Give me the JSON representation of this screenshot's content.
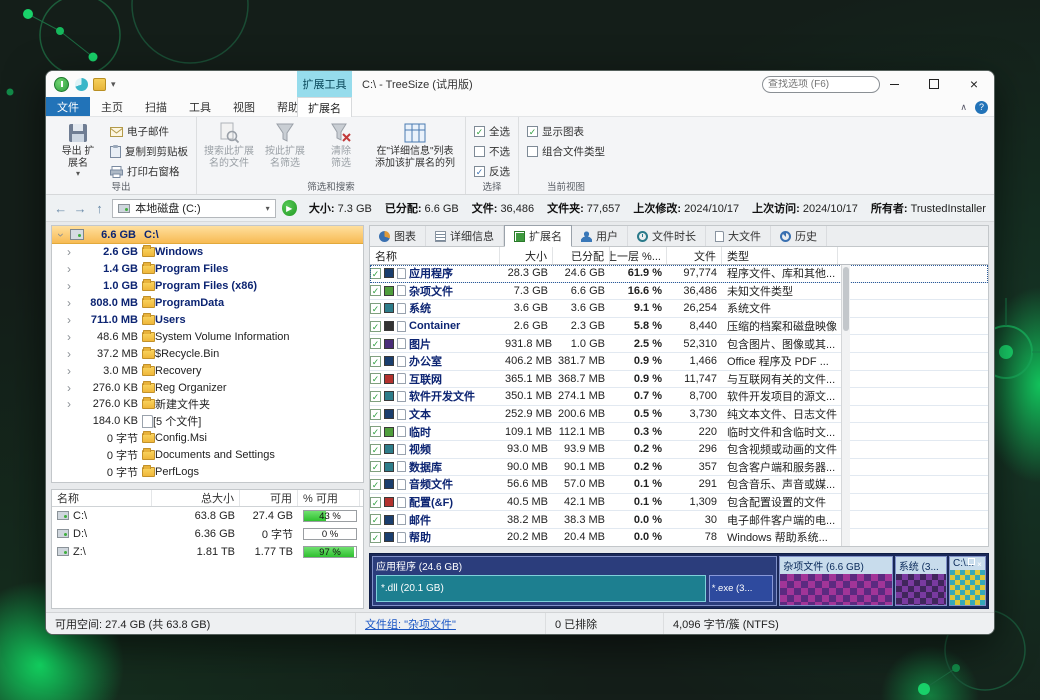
{
  "window": {
    "title": "C:\\ - TreeSize (试用版)",
    "search_placeholder": "查找选项 (F6)",
    "context_group": "扩展工具"
  },
  "ribbon": {
    "tabs": [
      "文件",
      "主页",
      "扫描",
      "工具",
      "视图",
      "帮助"
    ],
    "context_tab": "扩展名",
    "export": {
      "label": "导出",
      "main": "导出 扩\n展名",
      "email": "电子邮件",
      "clipboard": "复制到剪贴板",
      "print": "打印右窗格"
    },
    "filter": {
      "label": "筛选和搜索",
      "search": "搜索此扩展\n名的文件",
      "filter_btn": "按此扩展\n名筛选",
      "clear": "清除\n筛选",
      "addcol": "在\"详细信息\"列表\n添加该扩展名的列"
    },
    "select": {
      "label": "选择",
      "all": "全选",
      "none": "不选",
      "invert": "反选"
    },
    "view": {
      "label": "当前视图",
      "chart": "显示图表",
      "combine": "组合文件类型"
    }
  },
  "addressbar": {
    "location": "本地磁盘 (C:)",
    "stats": [
      {
        "label": "大小:",
        "value": "7.3 GB"
      },
      {
        "label": "已分配:",
        "value": "6.6 GB"
      },
      {
        "label": "文件:",
        "value": "36,486"
      },
      {
        "label": "文件夹:",
        "value": "77,657"
      },
      {
        "label": "上次修改:",
        "value": "2024/10/17"
      },
      {
        "label": "上次访问:",
        "value": "2024/10/17"
      },
      {
        "label": "所有者:",
        "value": "TrustedInstaller"
      }
    ]
  },
  "tree": {
    "root": {
      "size": "6.6 GB",
      "name": "C:\\"
    },
    "items": [
      {
        "size": "2.6 GB",
        "name": "Windows",
        "bold": true,
        "chevron": true,
        "icon": "folder"
      },
      {
        "size": "1.4 GB",
        "name": "Program Files",
        "bold": true,
        "chevron": true,
        "icon": "folder"
      },
      {
        "size": "1.0 GB",
        "name": "Program Files (x86)",
        "bold": true,
        "chevron": true,
        "icon": "folder"
      },
      {
        "size": "808.0 MB",
        "name": "ProgramData",
        "bold": true,
        "chevron": true,
        "icon": "folder"
      },
      {
        "size": "711.0 MB",
        "name": "Users",
        "bold": true,
        "chevron": true,
        "icon": "folder"
      },
      {
        "size": "48.6 MB",
        "name": "System Volume Information",
        "bold": false,
        "chevron": true,
        "icon": "folder"
      },
      {
        "size": "37.2 MB",
        "name": "$Recycle.Bin",
        "bold": false,
        "chevron": true,
        "icon": "folder"
      },
      {
        "size": "3.0 MB",
        "name": "Recovery",
        "bold": false,
        "chevron": true,
        "icon": "folder"
      },
      {
        "size": "276.0 KB",
        "name": "Reg Organizer",
        "bold": false,
        "chevron": true,
        "icon": "folder"
      },
      {
        "size": "276.0 KB",
        "name": "新建文件夹",
        "bold": false,
        "chevron": true,
        "icon": "folder"
      },
      {
        "size": "184.0 KB",
        "name": "[5 个文件]",
        "bold": false,
        "chevron": false,
        "icon": "files"
      },
      {
        "size": "0 字节",
        "name": "Config.Msi",
        "bold": false,
        "chevron": false,
        "icon": "folder"
      },
      {
        "size": "0 字节",
        "name": "Documents and Settings",
        "bold": false,
        "chevron": false,
        "icon": "folder"
      },
      {
        "size": "0 字节",
        "name": "PerfLogs",
        "bold": false,
        "chevron": false,
        "icon": "folder"
      }
    ]
  },
  "drives": {
    "headers": [
      "名称",
      "总大小",
      "可用",
      "% 可用"
    ],
    "rows": [
      {
        "name": "C:\\",
        "total": "63.8 GB",
        "free": "27.4 GB",
        "pct_label": "43 %",
        "pct": 43
      },
      {
        "name": "D:\\",
        "total": "6.36 GB",
        "free": "0 字节",
        "pct_label": "0 %",
        "pct": 0
      },
      {
        "name": "Z:\\",
        "total": "1.81 TB",
        "free": "1.77 TB",
        "pct_label": "97 %",
        "pct": 97
      }
    ]
  },
  "view_tabs": [
    {
      "label": "图表",
      "icon": "pie",
      "active": false
    },
    {
      "label": "详细信息",
      "icon": "list",
      "active": false
    },
    {
      "label": "扩展名",
      "icon": "ext",
      "active": true
    },
    {
      "label": "用户",
      "icon": "user",
      "active": false
    },
    {
      "label": "文件时长",
      "icon": "clock",
      "active": false
    },
    {
      "label": "大文件",
      "icon": "file",
      "active": false
    },
    {
      "label": "历史",
      "icon": "history",
      "active": false
    }
  ],
  "ext_table": {
    "headers": [
      "名称",
      "大小",
      "已分配",
      "占上一层 %...",
      "文件",
      "类型"
    ],
    "rows": [
      {
        "name": "应用程序",
        "size": "28.3 GB",
        "alloc": "24.6 GB",
        "pct": "61.9 %",
        "files": "97,774",
        "type": "程序文件、库和其他...",
        "color": "#1a3e6e",
        "selected": true
      },
      {
        "name": "杂项文件",
        "size": "7.3 GB",
        "alloc": "6.6 GB",
        "pct": "16.6 %",
        "files": "36,486",
        "type": "未知文件类型",
        "color": "#4f9e3c",
        "selected": false
      },
      {
        "name": "系统",
        "size": "3.6 GB",
        "alloc": "3.6 GB",
        "pct": "9.1 %",
        "files": "26,254",
        "type": "系统文件",
        "color": "#2e7d8a",
        "selected": false
      },
      {
        "name": "Container",
        "size": "2.6 GB",
        "alloc": "2.3 GB",
        "pct": "5.8 %",
        "files": "8,440",
        "type": "压缩的档案和磁盘映像",
        "color": "#333333",
        "selected": false
      },
      {
        "name": "图片",
        "size": "931.8 MB",
        "alloc": "1.0 GB",
        "pct": "2.5 %",
        "files": "52,310",
        "type": "包含图片、图像或其...",
        "color": "#4a2d7a",
        "selected": false
      },
      {
        "name": "办公室",
        "size": "406.2 MB",
        "alloc": "381.7 MB",
        "pct": "0.9 %",
        "files": "1,466",
        "type": "Office 程序及 PDF ...",
        "color": "#1a3e6e",
        "selected": false
      },
      {
        "name": "互联网",
        "size": "365.1 MB",
        "alloc": "368.7 MB",
        "pct": "0.9 %",
        "files": "11,747",
        "type": "与互联网有关的文件...",
        "color": "#b3322e",
        "selected": false
      },
      {
        "name": "软件开发文件",
        "size": "350.1 MB",
        "alloc": "274.1 MB",
        "pct": "0.7 %",
        "files": "8,700",
        "type": "软件开发项目的源文...",
        "color": "#2e7d8a",
        "selected": false
      },
      {
        "name": "文本",
        "size": "252.9 MB",
        "alloc": "200.6 MB",
        "pct": "0.5 %",
        "files": "3,730",
        "type": "纯文本文件、日志文件",
        "color": "#1a3e6e",
        "selected": false
      },
      {
        "name": "临时",
        "size": "109.1 MB",
        "alloc": "112.1 MB",
        "pct": "0.3 %",
        "files": "220",
        "type": "临时文件和含临时文...",
        "color": "#4f9e3c",
        "selected": false
      },
      {
        "name": "视频",
        "size": "93.0 MB",
        "alloc": "93.9 MB",
        "pct": "0.2 %",
        "files": "296",
        "type": "包含视频或动画的文件",
        "color": "#2e7d8a",
        "selected": false
      },
      {
        "name": "数据库",
        "size": "90.0 MB",
        "alloc": "90.1 MB",
        "pct": "0.2 %",
        "files": "357",
        "type": "包含客户端和服务器...",
        "color": "#2e7d8a",
        "selected": false
      },
      {
        "name": "音频文件",
        "size": "56.6 MB",
        "alloc": "57.0 MB",
        "pct": "0.1 %",
        "files": "291",
        "type": "包含音乐、声音或媒...",
        "color": "#1a3e6e",
        "selected": false
      },
      {
        "name": "配置(&F)",
        "size": "40.5 MB",
        "alloc": "42.1 MB",
        "pct": "0.1 %",
        "files": "1,309",
        "type": "包含配置设置的文件",
        "color": "#b3322e",
        "selected": false
      },
      {
        "name": "邮件",
        "size": "38.2 MB",
        "alloc": "38.3 MB",
        "pct": "0.0 %",
        "files": "30",
        "type": "电子邮件客户端的电...",
        "color": "#1a3e6e",
        "selected": false
      },
      {
        "name": "帮助",
        "size": "20.2 MB",
        "alloc": "20.4 MB",
        "pct": "0.0 %",
        "files": "78",
        "type": "Windows 帮助系统...",
        "color": "#1a3e6e",
        "selected": false
      }
    ]
  },
  "treemap": {
    "app": {
      "label": "应用程序 (24.6 GB)",
      "dll": "*.dll (20.1 GB)",
      "exe": "*.exe (3..."
    },
    "misc": {
      "label": "杂项文件 (6.6 GB)"
    },
    "system": {
      "label": "系统 (3..."
    },
    "root": {
      "label": "C:\\..."
    }
  },
  "statusbar": {
    "free_space": "可用空间: 27.4 GB  (共 63.8 GB)",
    "file_group": "文件组: \"杂项文件\"",
    "excluded": "0 已排除",
    "cluster": "4,096 字节/簇 (NTFS)"
  }
}
